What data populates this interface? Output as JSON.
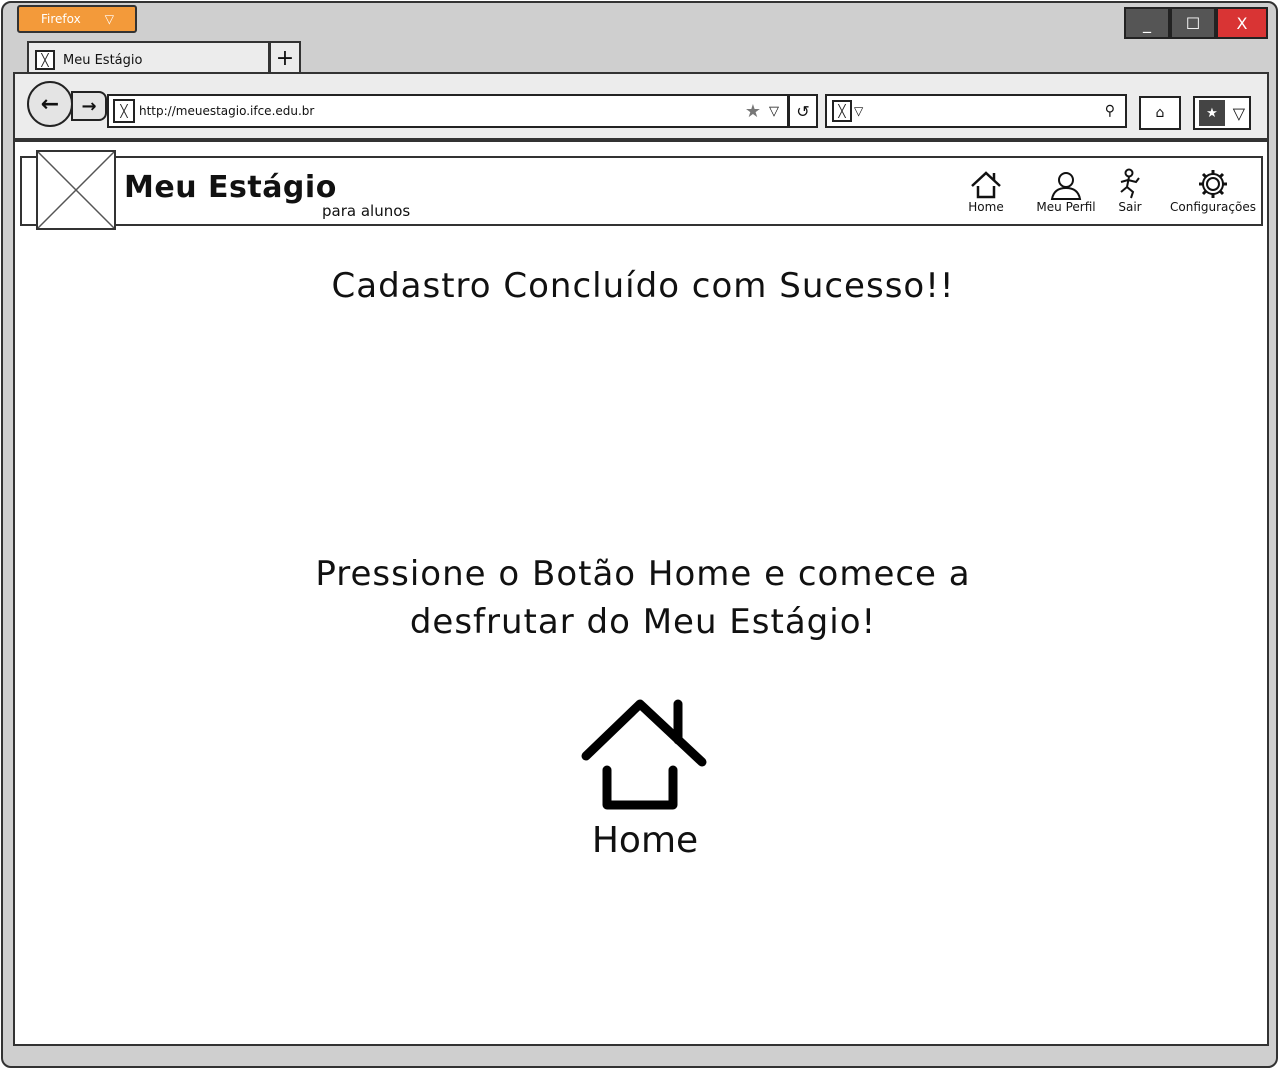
{
  "browser": {
    "menu_label": "Firefox",
    "tab_title": "Meu Estágio",
    "new_tab_label": "+",
    "url": "http://meuestagio.ifce.edu.br",
    "window_controls": {
      "minimize": "_",
      "maximize": "☐",
      "close": "X"
    }
  },
  "site": {
    "title": "Meu Estágio",
    "subtitle": "para alunos",
    "nav": [
      {
        "label": "Home",
        "icon": "home-icon"
      },
      {
        "label": "Meu Perfil",
        "icon": "user-icon"
      },
      {
        "label": "Sair",
        "icon": "exit-icon"
      },
      {
        "label": "Configurações",
        "icon": "gear-icon"
      }
    ]
  },
  "main": {
    "heading": "Cadastro Concluído com Sucesso!!",
    "message_line1": "Pressione o Botão Home e comece a",
    "message_line2": "desfrutar do Meu Estágio!",
    "home_button_label": "Home"
  }
}
